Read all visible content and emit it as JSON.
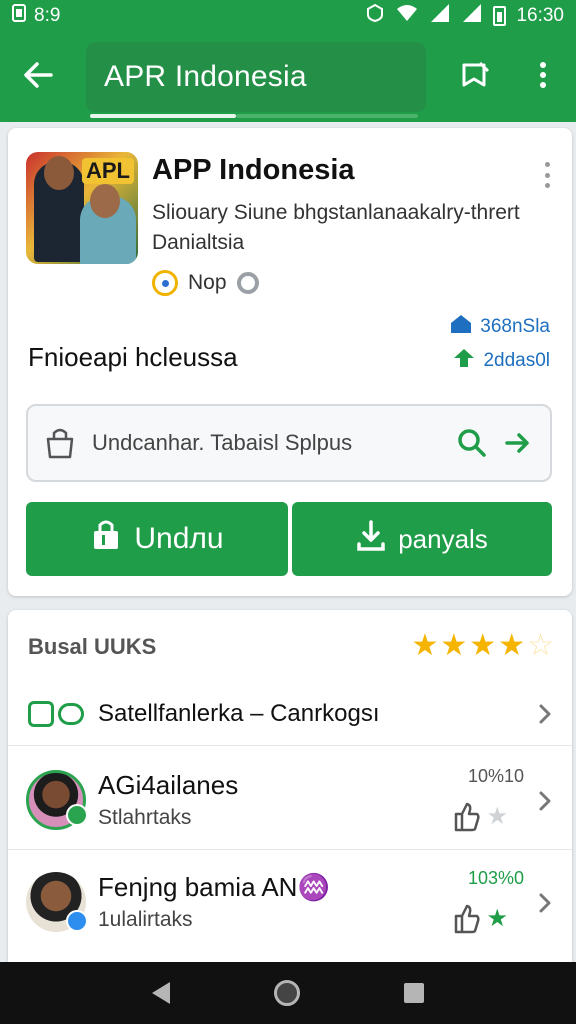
{
  "status_bar": {
    "left_icon": "sim-card-icon",
    "left_text": "8:9",
    "time": "16:30",
    "icons": [
      "vpn-icon",
      "wifi-icon",
      "signal-icon",
      "signal-icon",
      "battery-icon"
    ]
  },
  "app_bar": {
    "title": "APR Indonesia",
    "back_icon": "arrow-left-icon",
    "bookmark_icon": "bookmark-icon",
    "menu_icon": "more-vert-icon"
  },
  "app_card": {
    "thumbnail_label": "APL",
    "name": "APP Indonesia",
    "description": "Sliouary Siune bhgstanlanaakalry-thrert Danialtsia",
    "developer": "Nop",
    "stats": [
      "368nSla",
      "2ddas0l"
    ],
    "category": "Fnioeapi hcleussa",
    "search_text": "Undcanhar. Tabaisl Splpus",
    "primary_button": "Undлu",
    "secondary_button": "panyals"
  },
  "reviews_card": {
    "title": "Busal UUKS",
    "rating": 4,
    "rating_max": 5,
    "link_row": "Satellfanlerka – Canrkogsı",
    "people": [
      {
        "name": "AGi4ailanes",
        "subtitle": "Stlahrtaks",
        "meta": "10%10",
        "meta_color": "grey"
      },
      {
        "name": "Fenjng bamia AN♒",
        "subtitle": "1ulalirtaks",
        "meta": "103%0",
        "meta_color": "green"
      }
    ]
  },
  "colors": {
    "brand_green": "#1f9d49",
    "star_gold": "#f4b400",
    "link_blue": "#1e6fbf"
  }
}
